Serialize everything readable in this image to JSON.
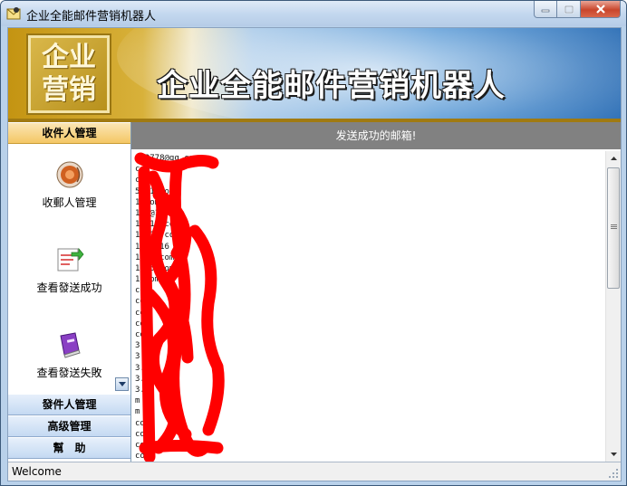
{
  "window": {
    "title": "企业全能邮件营销机器人"
  },
  "banner": {
    "logo_line1": "企业",
    "logo_line2": "营销",
    "title": "企业全能邮件营销机器人"
  },
  "sidebar": {
    "groups": [
      {
        "label": "收件人管理",
        "active": true
      },
      {
        "label": "發件人管理",
        "active": false
      },
      {
        "label": "高级管理",
        "active": false
      },
      {
        "label": "幫　助",
        "active": false
      }
    ],
    "items": [
      {
        "label": "收郵人管理",
        "icon": "speaker-icon"
      },
      {
        "label": "查看發送成功",
        "icon": "document-arrow-icon"
      },
      {
        "label": "查看發送失敗",
        "icon": "purple-book-icon"
      }
    ]
  },
  "content": {
    "header": "发送成功的邮箱!",
    "rows": [
      "892778@qq.com",
      "com",
      "com",
      "57@1 com",
      "1 com",
      "1 7@16 com",
      "1 @16 com",
      "1 @16 com",
      "1 15 16 com",
      "1 16 com",
      "1 15 com",
      "1 com",
      "com",
      "com",
      "com",
      "com",
      "com",
      "3.c",
      "3.c",
      "3.c",
      "3.c",
      "3.c",
      "m",
      "m",
      "com",
      "com",
      "com",
      "com"
    ],
    "colors": {
      "header_bg": "#818181",
      "redaction": "#ff0000"
    }
  },
  "statusbar": {
    "text": "Welcome"
  }
}
